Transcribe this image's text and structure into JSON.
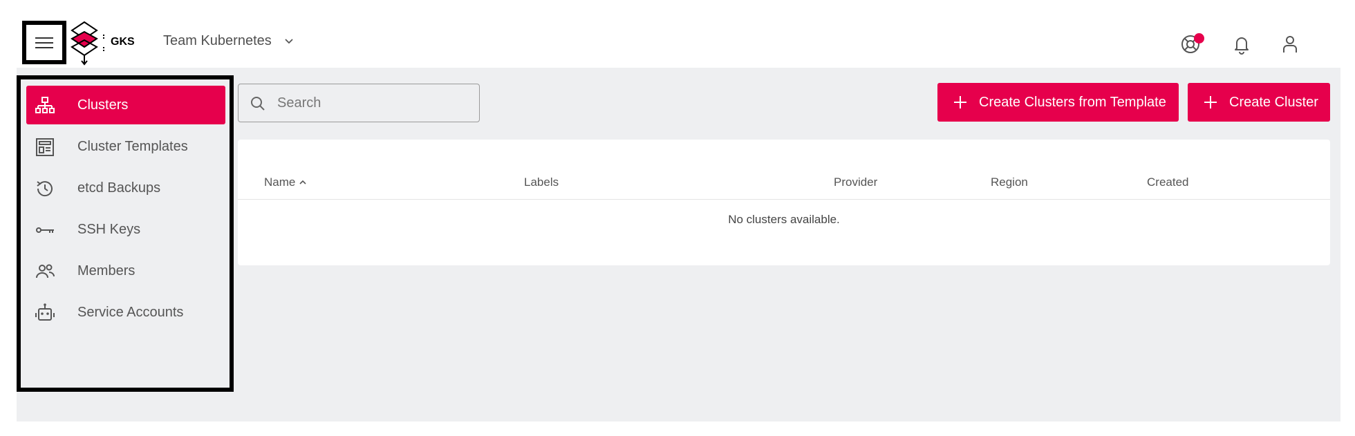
{
  "header": {
    "brand": "GKS",
    "project": "Team Kubernetes",
    "icons": [
      "menu-icon",
      "logo",
      "chevron-down-icon",
      "help-icon",
      "bell-icon",
      "account-icon"
    ]
  },
  "sidebar": {
    "items": [
      {
        "label": "Clusters",
        "icon": "sitemap-icon",
        "active": true
      },
      {
        "label": "Cluster Templates",
        "icon": "template-icon",
        "active": false
      },
      {
        "label": "etcd Backups",
        "icon": "history-icon",
        "active": false
      },
      {
        "label": "SSH Keys",
        "icon": "key-icon",
        "active": false
      },
      {
        "label": "Members",
        "icon": "members-icon",
        "active": false
      },
      {
        "label": "Service Accounts",
        "icon": "robot-icon",
        "active": false
      }
    ]
  },
  "toolbar": {
    "search_placeholder": "Search",
    "create_from_template_label": "Create Clusters from Template",
    "create_cluster_label": "Create Cluster"
  },
  "table": {
    "columns": [
      "Name",
      "Labels",
      "Provider",
      "Region",
      "Created"
    ],
    "empty_message": "No clusters available."
  },
  "colors": {
    "accent": "#e6004c",
    "background": "#eeeff1",
    "card": "#ffffff"
  }
}
